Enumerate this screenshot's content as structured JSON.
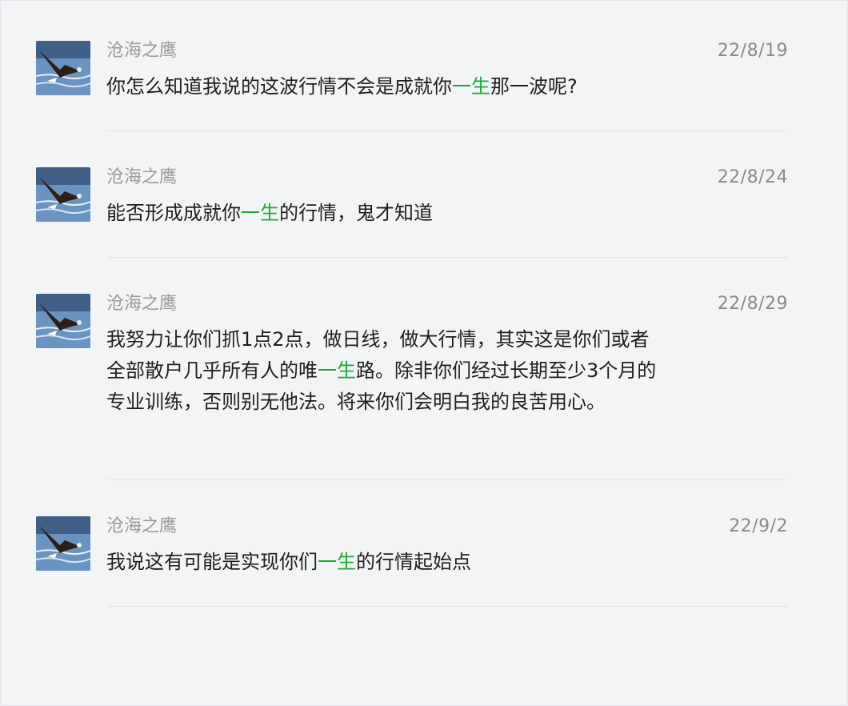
{
  "comments": [
    {
      "author": "沧海之鹰",
      "date": "22/8/19",
      "text_parts": [
        "你怎么知道我说的这波行情不会是成就你",
        "一生",
        "那一波呢?"
      ]
    },
    {
      "author": "沧海之鹰",
      "date": "22/8/24",
      "text_parts": [
        "能否形成成就你",
        "一生",
        "的行情，鬼才知道"
      ]
    },
    {
      "author": "沧海之鹰",
      "date": "22/8/29",
      "text_parts": [
        "我努力让你们抓1点2点，做日线，做大行情，其实这是你们或者全部散户几乎所有人的唯",
        "一生",
        "路。除非你们经过长期至少3个月的专业训练，否则别无他法。将来你们会明白我的良苦用心。"
      ]
    },
    {
      "author": "沧海之鹰",
      "date": "22/9/2",
      "text_parts": [
        "我说这有可能是实现你们",
        "一生",
        "的行情起始点"
      ]
    }
  ],
  "colors": {
    "highlight": "#1ea83c",
    "author": "#9a9a9a",
    "date": "#8a8a8a",
    "background": "#f3f4f6",
    "separator": "#e1e3e6"
  },
  "icons": {
    "avatar": "eagle-over-water-avatar"
  }
}
